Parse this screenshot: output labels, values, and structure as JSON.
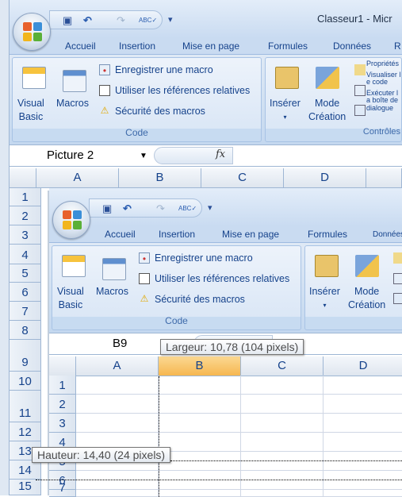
{
  "window": {
    "title": "Classeur1 - Micr"
  },
  "qat": {
    "save": "save-icon",
    "undo": "↶",
    "redo": "↷",
    "spell": "ABC✓",
    "customize": "▾"
  },
  "tabs": [
    "Accueil",
    "Insertion",
    "Mise en page",
    "Formules",
    "Données",
    "R"
  ],
  "ribbon": {
    "code_group": {
      "label": "Code",
      "visual_basic": [
        "Visual",
        "Basic"
      ],
      "macros": "Macros",
      "record": "Enregistrer une macro",
      "relative": "Utiliser les références relatives",
      "security": "Sécurité des macros"
    },
    "controls_group": {
      "label": "Contrôles",
      "insert": "Insérer",
      "insert_arrow": "▾",
      "design_mode": [
        "Mode",
        "Création"
      ],
      "properties": "Propriétés",
      "view_code": "Visualiser le code",
      "run_dialog": "Exécuter la boîte de dialogue"
    }
  },
  "formula_bar": {
    "name_box": "Picture 2",
    "fx": "fx",
    "value": ""
  },
  "columns": [
    "A",
    "B",
    "C",
    "D"
  ],
  "rows": [
    "1",
    "2",
    "3",
    "4",
    "5",
    "6",
    "7",
    "8",
    "9",
    "10",
    "11",
    "12",
    "13",
    "14",
    "15"
  ],
  "picture": {
    "name_box": "B9",
    "selected_column": "B",
    "rows": [
      "1",
      "2",
      "3",
      "4",
      "5",
      "6",
      "7"
    ],
    "colors": {
      "selected_header": "#f9c56b"
    }
  },
  "tooltips": {
    "width": "Largeur: 10,78 (104 pixels)",
    "height": "Hauteur: 14,40 (24 pixels)"
  }
}
